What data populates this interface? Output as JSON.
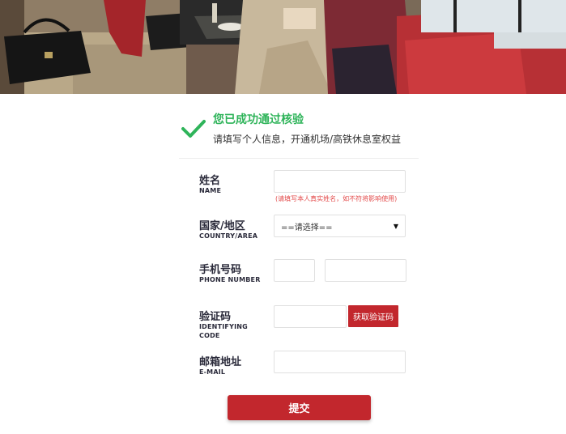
{
  "banner": {
    "title": "您已成功通过核验",
    "subtitle": "请填写个人信息，开通机场/高铁休息室权益",
    "icon": "checkmark-icon",
    "title_color": "#2fb45a"
  },
  "form": {
    "name": {
      "label_cn": "姓名",
      "label_en": "NAME",
      "value": "",
      "hint": "(请填写本人真实姓名，如不符将影响使用)"
    },
    "country": {
      "label_cn": "国家/地区",
      "label_en": "COUNTRY/AREA",
      "selected": "==请选择=="
    },
    "phone": {
      "label_cn": "手机号码",
      "label_en": "PHONE NUMBER",
      "code_value": "",
      "number_value": ""
    },
    "verify": {
      "label_cn": "验证码",
      "label_en_1": "IDENTIFYING",
      "label_en_2": "CODE",
      "value": "",
      "button": "获取验证码"
    },
    "email": {
      "label_cn": "邮箱地址",
      "label_en": "E-MAIL",
      "value": ""
    },
    "submit": "提交"
  },
  "colors": {
    "accent": "#c2272d",
    "success": "#2fb45a",
    "hint": "#e34b4b"
  }
}
